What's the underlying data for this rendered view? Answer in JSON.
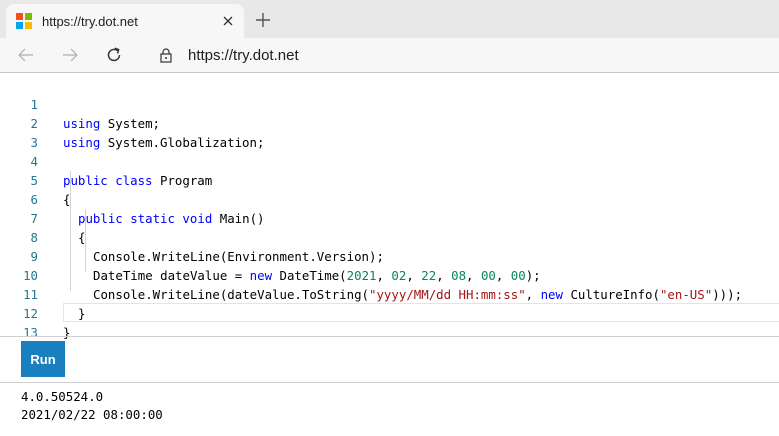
{
  "browser": {
    "tab_title": "https://try.dot.net",
    "address": "https://try.dot.net",
    "favicon_colors": [
      "#f25022",
      "#7fba00",
      "#00a4ef",
      "#ffb900"
    ],
    "icons": {
      "back": "arrow-left-icon",
      "forward": "arrow-right-icon",
      "reload": "reload-icon",
      "lock": "lock-icon",
      "close_tab": "close-icon",
      "new_tab": "plus-icon"
    }
  },
  "editor": {
    "line_numbers": [
      "1",
      "2",
      "3",
      "4",
      "5",
      "6",
      "7",
      "8",
      "9",
      "10",
      "11",
      "12",
      "13"
    ],
    "colors": {
      "keyword": "#0000ff",
      "string": "#a31515",
      "number": "#098658",
      "line_number": "#237893"
    }
  },
  "code": {
    "l1": {
      "kw": "using",
      "rest": " System;"
    },
    "l2": {
      "kw": "using",
      "rest": " System.Globalization;"
    },
    "l4": {
      "kw": "public class",
      "rest": " Program"
    },
    "l5": {
      "text": "{"
    },
    "l6": {
      "kw": "public static void",
      "rest": " Main()"
    },
    "l7": {
      "text": "{"
    },
    "l8": {
      "text": "Console.WriteLine(Environment.Version);"
    },
    "l9": {
      "a": "DateTime dateValue = ",
      "kw": "new",
      "b": " DateTime(",
      "n1": "2021",
      "c1": ", ",
      "n2": "02",
      "c2": ", ",
      "n3": "22",
      "c3": ", ",
      "n4": "08",
      "c4": ", ",
      "n5": "00",
      "c5": ", ",
      "n6": "00",
      "end": ");"
    },
    "l10": {
      "a": "Console.WriteLine(dateValue.ToString(",
      "s1": "\"yyyy/MM/dd HH:mm:ss\"",
      "c": ", ",
      "kw": "new",
      "b": " CultureInfo(",
      "s2": "\"en-US\"",
      "end": ")));"
    },
    "l11": {
      "text": "}"
    },
    "l12": {
      "text": "}"
    }
  },
  "run_button": {
    "label": "Run",
    "color": "#1a7fbf"
  },
  "output": {
    "line1": "4.0.50524.0",
    "line2": "2021/02/22 08:00:00"
  }
}
